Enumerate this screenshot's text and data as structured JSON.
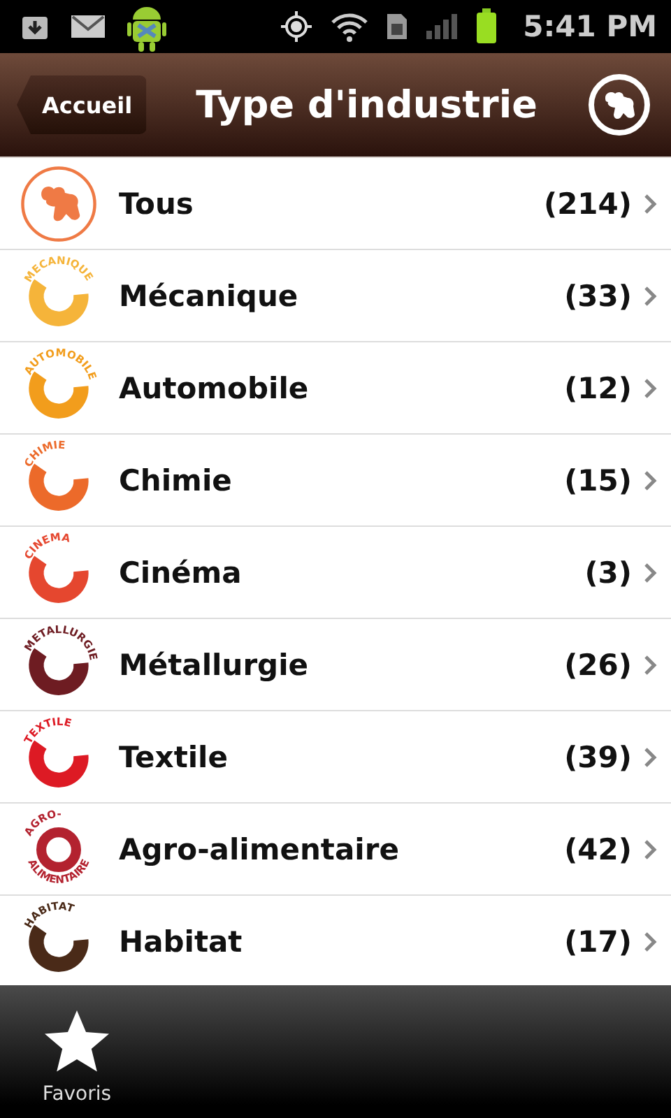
{
  "status_bar": {
    "time": "5:41 PM"
  },
  "header": {
    "back": "Accueil",
    "title": "Type d'industrie"
  },
  "items": [
    {
      "kind": "logo",
      "label": "Tous",
      "count": "(214)",
      "color": "#ef7a45"
    },
    {
      "kind": "ring",
      "label": "Mécanique",
      "count": "(33)",
      "color": "#f5b43a",
      "icon_texts": [
        "MECANIQUE"
      ]
    },
    {
      "kind": "ring",
      "label": "Automobile",
      "count": "(12)",
      "color": "#f29d1c",
      "icon_texts": [
        "AUTOMOBILE"
      ]
    },
    {
      "kind": "ring",
      "label": "Chimie",
      "count": "(15)",
      "color": "#ec6a2a",
      "icon_texts": [
        "CHIMIE"
      ]
    },
    {
      "kind": "ring",
      "label": "Cinéma",
      "count": "(3)",
      "color": "#e5472f",
      "icon_texts": [
        "CINEMA"
      ]
    },
    {
      "kind": "ring",
      "label": "Métallurgie",
      "count": "(26)",
      "color": "#6e1c22",
      "icon_texts": [
        "METALLURGIE"
      ]
    },
    {
      "kind": "ring",
      "label": "Textile",
      "count": "(39)",
      "color": "#dd1a24",
      "icon_texts": [
        "TEXTILE"
      ]
    },
    {
      "kind": "ring",
      "label": "Agro-alimentaire",
      "count": "(42)",
      "color": "#b3222f",
      "icon_texts": [
        "AGRO-",
        "ALIMENTAIRE"
      ]
    },
    {
      "kind": "ring",
      "label": "Habitat",
      "count": "(17)",
      "color": "#4a2a18",
      "icon_texts": [
        "HABITAT"
      ]
    }
  ],
  "tab_bar": [
    {
      "label": "Favoris"
    }
  ]
}
